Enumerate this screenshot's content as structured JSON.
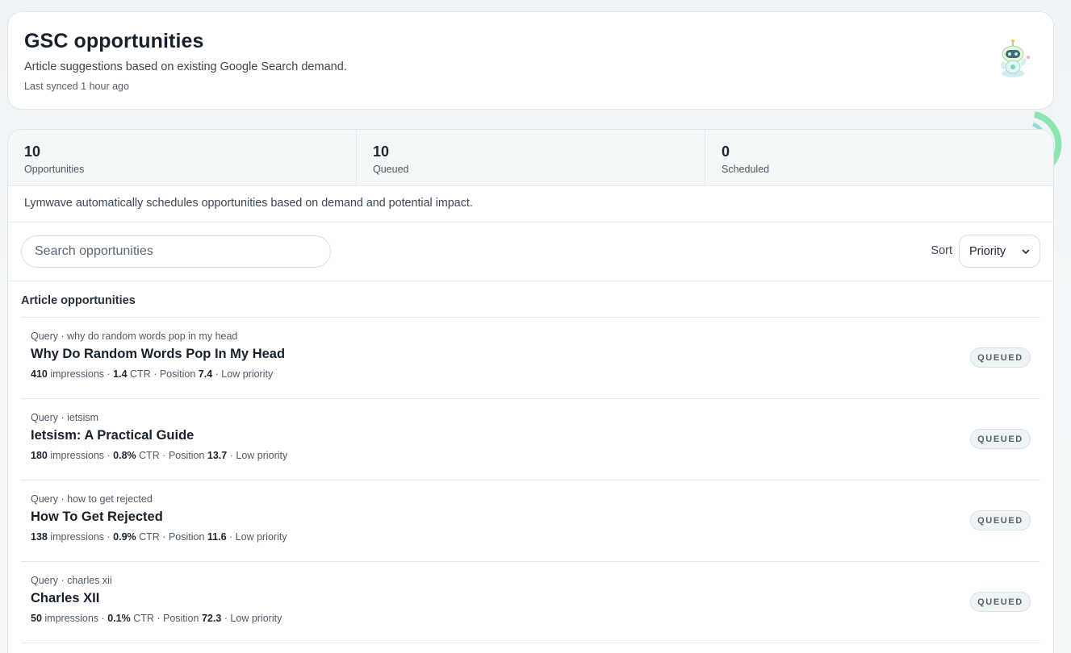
{
  "header": {
    "title": "GSC opportunities",
    "subtitle": "Article suggestions based on existing Google Search demand.",
    "synced": "Last synced 1 hour ago",
    "mascot_icon": "robot-mascot"
  },
  "stats": [
    {
      "value": "10",
      "label": "Opportunities"
    },
    {
      "value": "10",
      "label": "Queued"
    },
    {
      "value": "0",
      "label": "Scheduled"
    }
  ],
  "info_text": "Lymwave automatically schedules opportunities based on demand and potential impact.",
  "search": {
    "placeholder": "Search opportunities",
    "value": ""
  },
  "sort": {
    "label": "Sort",
    "selected": "Priority"
  },
  "list": {
    "heading": "Article opportunities",
    "items": [
      {
        "query": "Query · why do random words pop in my head",
        "title": "Why Do Random Words Pop In My Head",
        "impressions": "410",
        "impressions_label": "impressions ·",
        "ctr": "1.4",
        "ctr_label": "CTR · Position",
        "position": "7.4",
        "priority": "· Low priority",
        "status": "QUEUED"
      },
      {
        "query": "Query · ietsism",
        "title": "Ietsism: A Practical Guide",
        "impressions": "180",
        "impressions_label": "impressions ·",
        "ctr": "0.8%",
        "ctr_label": "CTR · Position",
        "position": "13.7",
        "priority": "· Low priority",
        "status": "QUEUED"
      },
      {
        "query": "Query · how to get rejected",
        "title": "How To Get Rejected",
        "impressions": "138",
        "impressions_label": "impressions ·",
        "ctr": "0.9%",
        "ctr_label": "CTR · Position",
        "position": "11.6",
        "priority": "· Low priority",
        "status": "QUEUED"
      },
      {
        "query": "Query · charles xii",
        "title": "Charles XII",
        "impressions": "50",
        "impressions_label": "impressions ·",
        "ctr": "0.1%",
        "ctr_label": "CTR · Position",
        "position": "72.3",
        "priority": "· Low priority",
        "status": "QUEUED"
      }
    ]
  },
  "colors": {
    "accent_arc_green": "#7ee3a8",
    "accent_arc_teal": "#8fd8dc"
  }
}
